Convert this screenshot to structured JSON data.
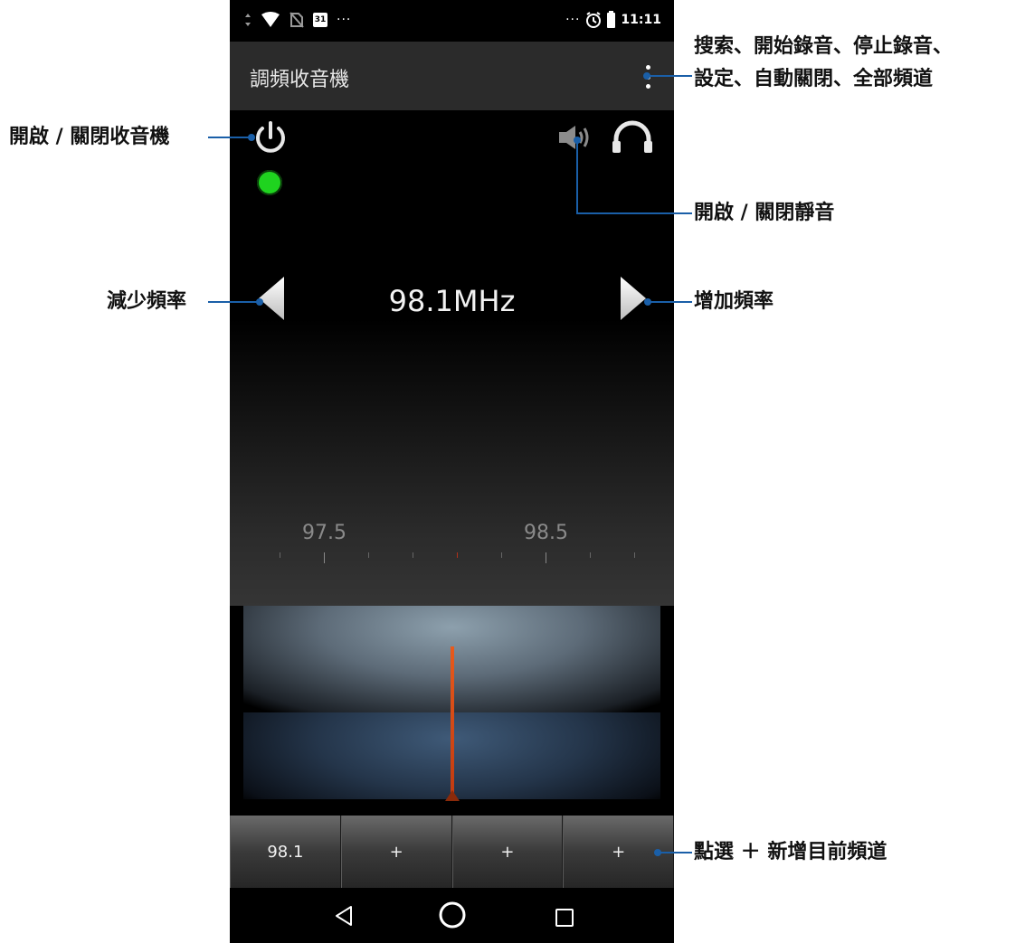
{
  "statusbar": {
    "calendar_day": "31",
    "left_dots": "···",
    "right_dots": "···",
    "time": "11:11"
  },
  "appbar": {
    "title": "調頻收音機"
  },
  "tuner": {
    "frequency_display": "98.1MHz",
    "power_state": "on",
    "scale_labels": [
      "97.5",
      "98.5"
    ],
    "needle_color": "#e85a1c",
    "status_color": "#1fd31f"
  },
  "presets": [
    "98.1",
    "+",
    "+",
    "+"
  ],
  "callouts": {
    "menu_line1": "搜索、開始錄音、停止錄音、",
    "menu_line2": "設定、自動關閉、全部頻道",
    "power": "開啟 / 關閉收音機",
    "mute": "開啟 / 關閉靜音",
    "decrease": "減少頻率",
    "increase": "增加頻率",
    "add_preset": "點選 ＋ 新增目前頻道"
  }
}
